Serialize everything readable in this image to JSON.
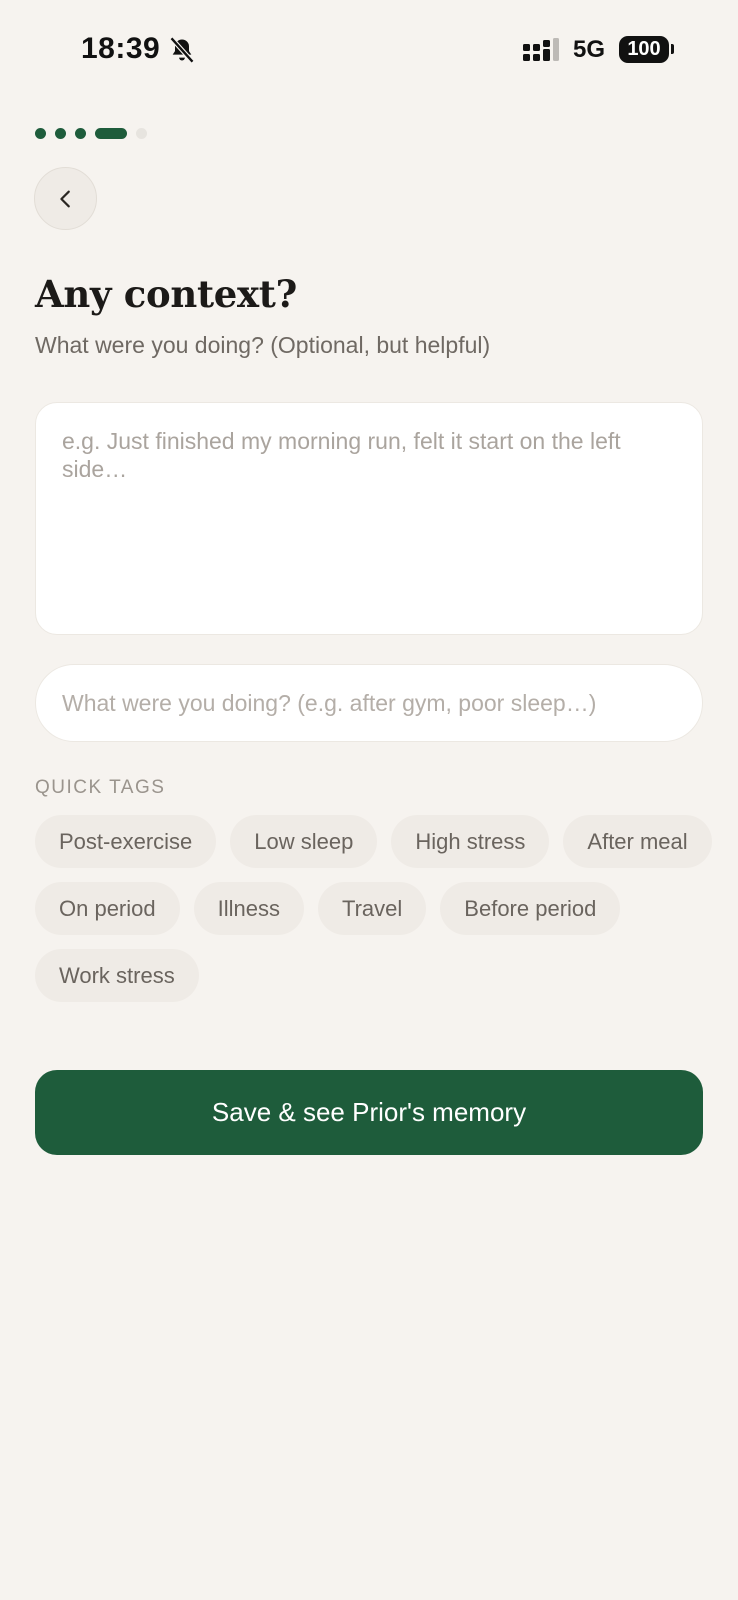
{
  "status_bar": {
    "time": "18:39",
    "network": "5G",
    "battery": "100",
    "icons": [
      "bell-muted-icon",
      "signal-icon"
    ]
  },
  "progress": {
    "total_steps": 5,
    "current_step": 4
  },
  "back": {
    "icon": "chevron-left-icon"
  },
  "heading": {
    "title": "Any context?",
    "subtitle": "What were you doing? (Optional, but helpful)"
  },
  "notes": {
    "value": "",
    "placeholder": "e.g. Just finished my morning run, felt it start on the left side…"
  },
  "context_input": {
    "value": "",
    "placeholder": "What were you doing? (e.g. after gym, poor sleep…)"
  },
  "quick_tags": {
    "label": "QUICK TAGS",
    "items": [
      "Post-exercise",
      "Low sleep",
      "High stress",
      "After meal",
      "On period",
      "Illness",
      "Travel",
      "Before period",
      "Work stress"
    ]
  },
  "save_button": {
    "label": "Save & see Prior's memory"
  },
  "colors": {
    "background": "#f6f3ef",
    "accent": "#1e5c3b",
    "tag_bg": "#efebe6"
  }
}
